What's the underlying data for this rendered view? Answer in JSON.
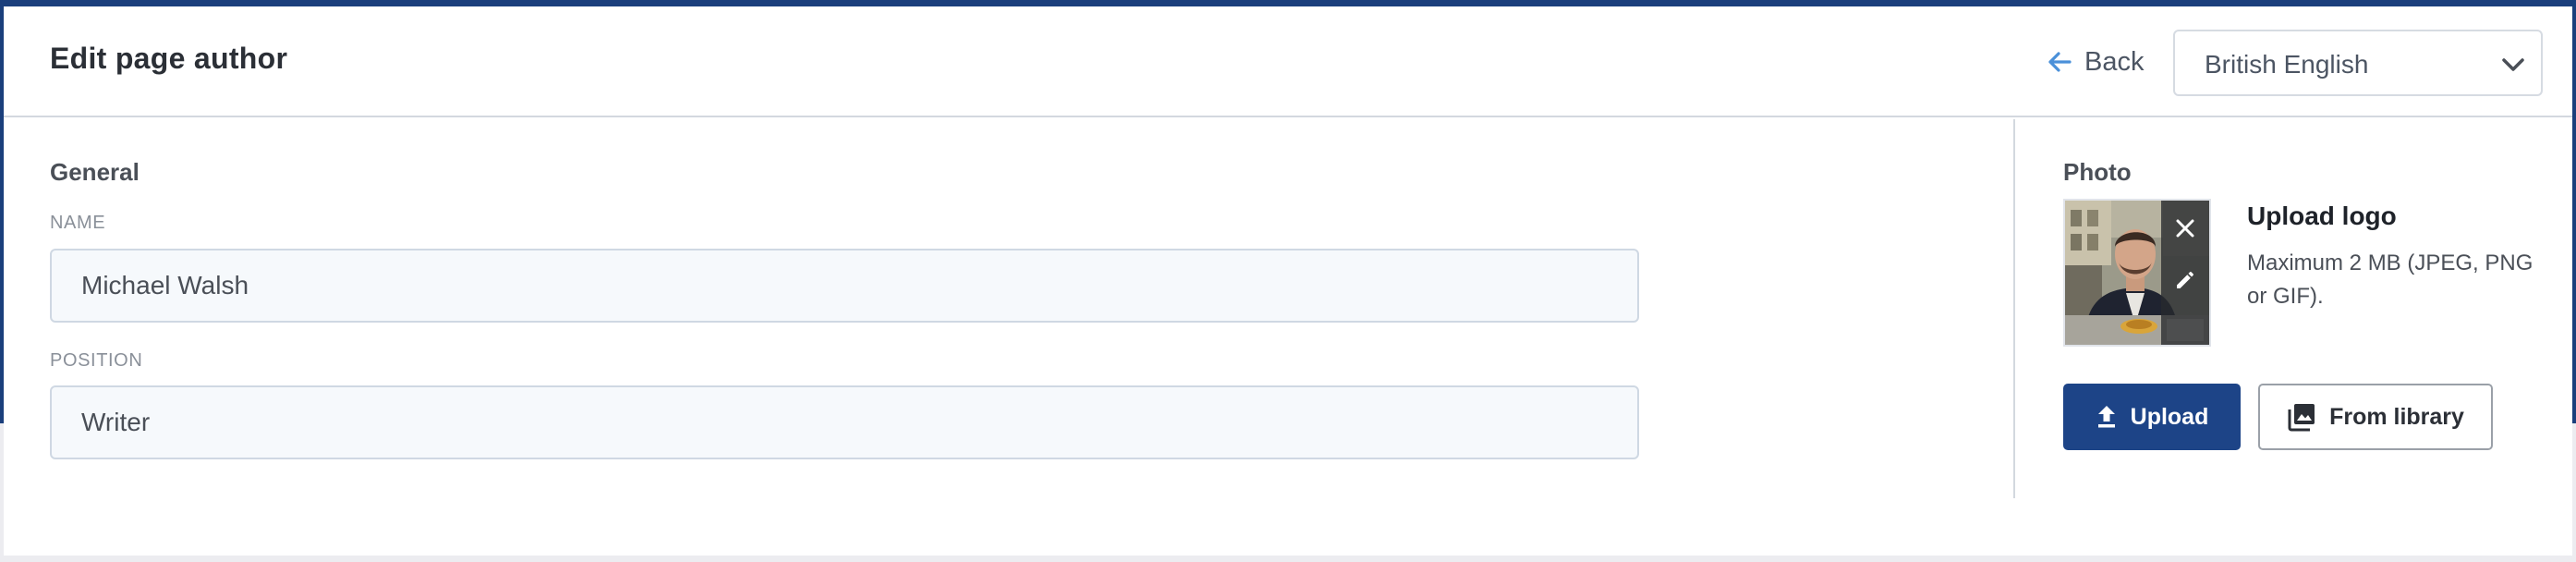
{
  "header": {
    "title": "Edit page author",
    "back_label": "Back",
    "language": "British English"
  },
  "general": {
    "section_title": "General",
    "name_label": "NAME",
    "name_value": "Michael Walsh",
    "position_label": "POSITION",
    "position_value": "Writer"
  },
  "photo": {
    "section_title": "Photo",
    "upload_title": "Upload logo",
    "upload_hint": "Maximum 2 MB (JPEG, PNG or GIF).",
    "upload_button": "Upload",
    "library_button": "From library"
  },
  "icons": {
    "back": "arrow-left-icon",
    "language_dropdown": "chevron-down-icon",
    "remove_photo": "close-icon",
    "edit_photo": "pencil-icon",
    "upload": "upload-icon",
    "library": "image-library-icon"
  },
  "colors": {
    "brand_navy": "#1d4487",
    "back_arrow": "#4a90d9",
    "input_background": "#f6f9fc"
  }
}
